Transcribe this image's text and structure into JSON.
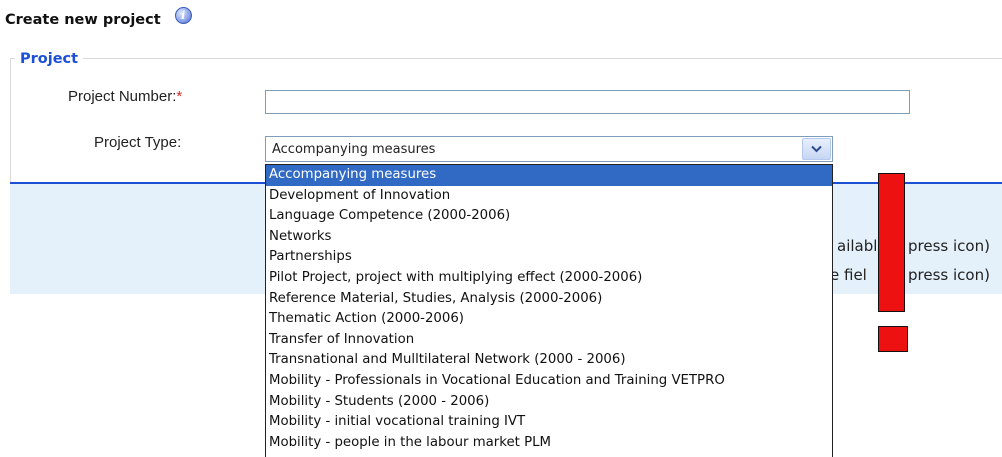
{
  "page": {
    "title": "Create new project",
    "info_icon_glyph": "i"
  },
  "fieldset": {
    "legend": "Project"
  },
  "project_number": {
    "label": "Project Number:",
    "required_marker": "*",
    "value": ""
  },
  "project_type": {
    "label": "Project Type:",
    "selected": "Accompanying measures",
    "options": [
      "Accompanying measures",
      "Development of Innovation",
      "Language Competence (2000-2006)",
      "Networks",
      "Partnerships",
      "Pilot Project, project with multiplying effect (2000-2006)",
      "Reference Material, Studies, Analysis (2000-2006)",
      "Thematic Action (2000-2006)",
      "Transfer of Innovation",
      "Transnational and Mulltilateral Network (2000 - 2006)",
      "Mobility - Professionals in Vocational Education and Training VETPRO",
      "Mobility - Students (2000 - 2006)",
      "Mobility - initial vocational training IVT",
      "Mobility - people in the labour market PLM"
    ]
  },
  "info_panel": {
    "line1_a": "ailabl",
    "line1_b": "press icon)",
    "line2_a": "e fiel",
    "line2_b": "press icon)"
  },
  "colors": {
    "legend": "#1b4fd6",
    "required": "#d8282a",
    "divider": "#1c4fd4",
    "panel_bg": "#e4f1fb",
    "selected_option_bg": "#316ac5",
    "annotation_red": "#ee1111"
  }
}
